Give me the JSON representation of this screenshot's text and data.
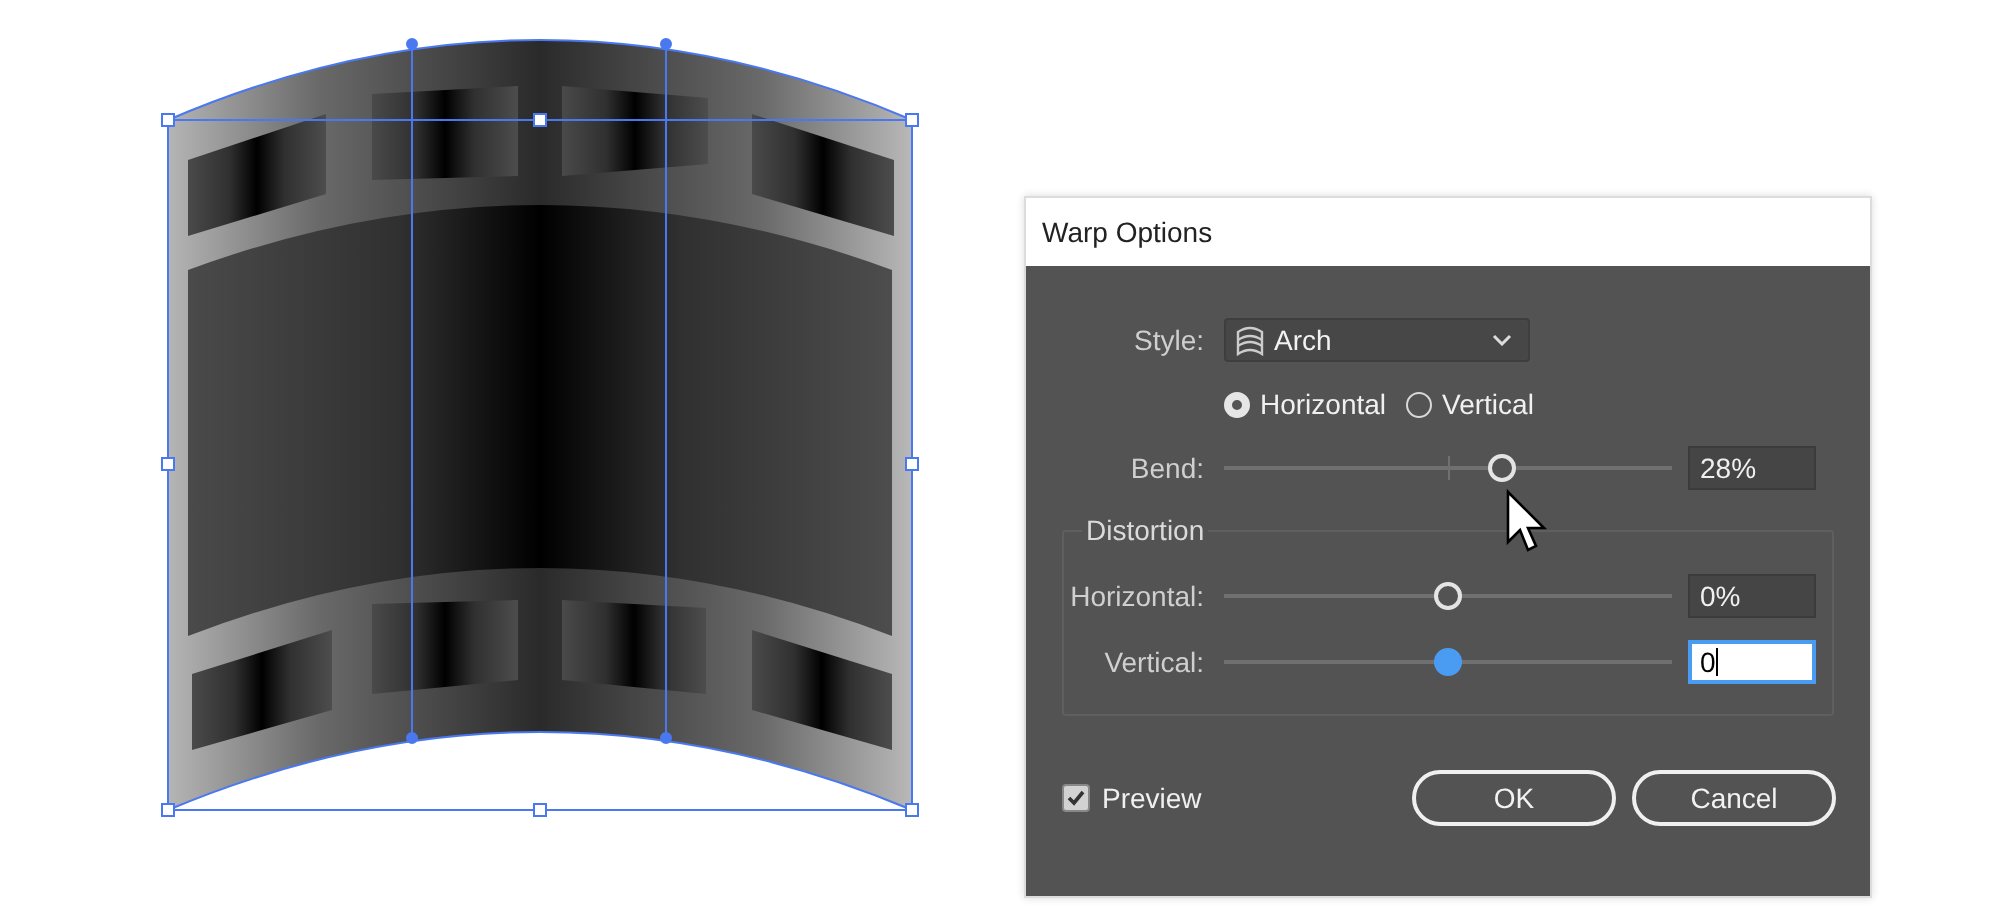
{
  "dialog": {
    "title": "Warp Options",
    "style": {
      "label": "Style:",
      "value": "Arch"
    },
    "orientation": [
      {
        "label": "Horizontal",
        "selected": true
      },
      {
        "label": "Vertical",
        "selected": false
      }
    ],
    "bend": {
      "label": "Bend:",
      "level": 0.63,
      "value": "28%",
      "active": false
    },
    "distortion": {
      "title": "Distortion",
      "sliders": [
        {
          "label": "Horizontal:",
          "level": 0.5,
          "value": "0%",
          "active": false
        },
        {
          "label": "Vertical:",
          "level": 0.5,
          "value": "0",
          "active": true
        }
      ]
    },
    "preview": {
      "label": "Preview",
      "checked": true
    },
    "buttons": [
      "OK",
      "Cancel"
    ]
  }
}
